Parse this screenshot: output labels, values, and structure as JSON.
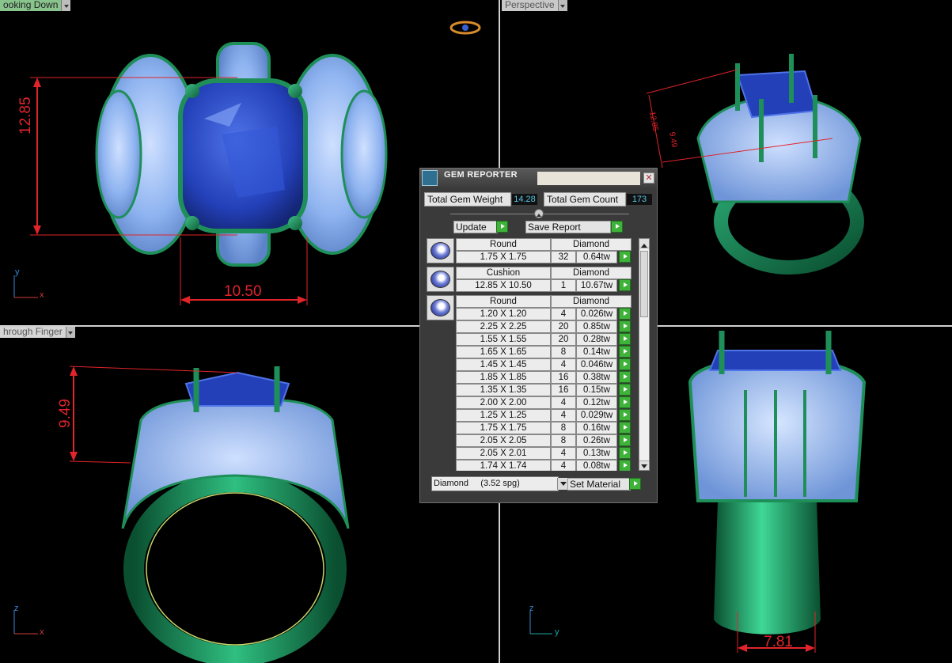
{
  "viewports": {
    "top_left_label": "ooking Down",
    "top_right_label": "Perspective",
    "bottom_left_label": "hrough Finger"
  },
  "dimensions": {
    "top_height": "12.85",
    "top_width": "10.50",
    "side_height": "9.49",
    "end_width": "7.81",
    "persp_a": "12.85",
    "persp_b": "9.49"
  },
  "axes": {
    "tl": [
      "y",
      "x"
    ],
    "bl": [
      "z",
      "x"
    ],
    "br": [
      "z",
      "y"
    ]
  },
  "gem_reporter": {
    "title": "GEM REPORTER",
    "close_glyph": "✕",
    "total_weight_label": "Total Gem Weight",
    "total_weight_value": "14.28",
    "total_count_label": "Total Gem Count",
    "total_count_value": "173",
    "update_label": "Update",
    "save_report_label": "Save Report",
    "groups": [
      {
        "shape": "Round",
        "material": "Diamond",
        "rows": [
          {
            "size": "1.75 X 1.75",
            "count": "32",
            "weight": "0.64tw"
          }
        ]
      },
      {
        "shape": "Cushion",
        "material": "Diamond",
        "rows": [
          {
            "size": "12.85 X 10.50",
            "count": "1",
            "weight": "10.67tw"
          }
        ]
      },
      {
        "shape": "Round",
        "material": "Diamond",
        "rows": [
          {
            "size": "1.20 X 1.20",
            "count": "4",
            "weight": "0.026tw"
          },
          {
            "size": "2.25 X 2.25",
            "count": "20",
            "weight": "0.85tw"
          },
          {
            "size": "1.55 X 1.55",
            "count": "20",
            "weight": "0.28tw"
          },
          {
            "size": "1.65 X 1.65",
            "count": "8",
            "weight": "0.14tw"
          },
          {
            "size": "1.45 X 1.45",
            "count": "4",
            "weight": "0.046tw"
          },
          {
            "size": "1.85 X 1.85",
            "count": "16",
            "weight": "0.38tw"
          },
          {
            "size": "1.35 X 1.35",
            "count": "16",
            "weight": "0.15tw"
          },
          {
            "size": "2.00 X 2.00",
            "count": "4",
            "weight": "0.12tw"
          },
          {
            "size": "1.25 X 1.25",
            "count": "4",
            "weight": "0.029tw"
          },
          {
            "size": "1.75 X 1.75",
            "count": "8",
            "weight": "0.16tw"
          },
          {
            "size": "2.05 X 2.05",
            "count": "8",
            "weight": "0.26tw"
          },
          {
            "size": "2.05 X 2.01",
            "count": "4",
            "weight": "0.13tw"
          },
          {
            "size": "1.74 X 1.74",
            "count": "4",
            "weight": "0.08tw"
          }
        ]
      }
    ],
    "material_select_value": "Diamond     (3.52 spg)",
    "set_material_label": "Set Material"
  },
  "colors": {
    "metal": "#1f8f5a",
    "pave": "#8fb4f0",
    "center_stone": "#2340b8",
    "dimension": "#e0242a",
    "accent_green": "#3fb23a"
  }
}
